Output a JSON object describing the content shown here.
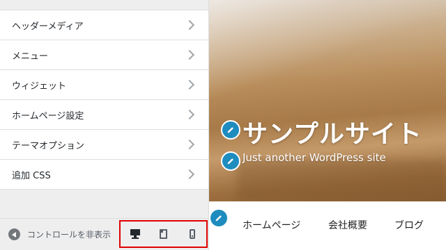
{
  "sidebar": {
    "items": [
      {
        "label": "ヘッダーメディア"
      },
      {
        "label": "メニュー"
      },
      {
        "label": "ウィジェット"
      },
      {
        "label": "ホームページ設定"
      },
      {
        "label": "テーマオプション"
      },
      {
        "label": "追加 CSS"
      }
    ],
    "collapse_label": "コントロールを非表示",
    "devices": [
      "desktop-icon",
      "tablet-icon",
      "mobile-icon"
    ]
  },
  "preview": {
    "site_title": "サンプルサイト",
    "tagline": "Just another WordPress site",
    "nav": [
      "ホームページ",
      "会社概要",
      "ブログ"
    ]
  },
  "colors": {
    "accent": "#1e8cbe",
    "highlight_border": "#e00000"
  }
}
